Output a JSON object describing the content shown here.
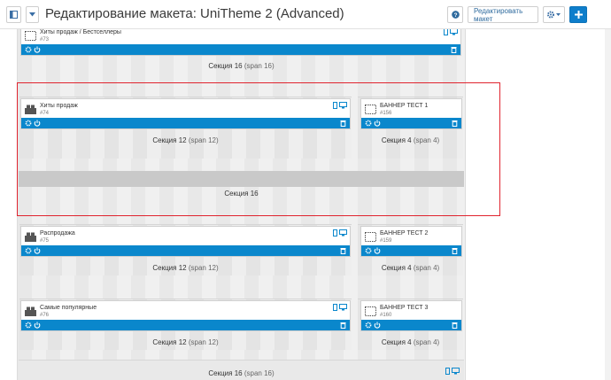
{
  "header": {
    "title": "Редактирование макета: UniTheme 2 (Advanced)",
    "edit_layout_label": "Редактировать макет",
    "icons": [
      "sidebar-toggle-icon",
      "chevron-down-icon",
      "help-icon",
      "gear-icon",
      "plus-icon"
    ]
  },
  "rows": [
    {
      "section_top": {
        "name": "Секция 16",
        "span": "(span 16)"
      },
      "blocks": [
        {
          "title": "Хиты продаж / Бестселлеры",
          "id": "#73",
          "icon": "template-icon"
        }
      ]
    },
    {
      "left": {
        "name": "Секция 12",
        "span": "(span 12)",
        "block": {
          "title": "Хиты продаж",
          "id": "#74",
          "icon": "products-icon"
        }
      },
      "right": {
        "name": "Секция 4",
        "span": "(span 4)",
        "block": {
          "title": "БАННЕР ТЕСТ 1",
          "id": "#156",
          "icon": "template-icon"
        }
      },
      "container_label": "Секция 16"
    },
    {
      "left": {
        "name": "Секция 12",
        "span": "(span 12)",
        "block": {
          "title": "Распродажа",
          "id": "#75",
          "icon": "products-icon"
        }
      },
      "right": {
        "name": "Секция 4",
        "span": "(span 4)",
        "block": {
          "title": "БАННЕР ТЕСТ 2",
          "id": "#159",
          "icon": "template-icon"
        }
      }
    },
    {
      "left": {
        "name": "Секция 12",
        "span": "(span 12)",
        "block": {
          "title": "Самые популярные",
          "id": "#76",
          "icon": "products-icon"
        }
      },
      "right": {
        "name": "Секция 4",
        "span": "(span 4)",
        "block": {
          "title": "БАННЕР ТЕСТ 3",
          "id": "#160",
          "icon": "template-icon"
        }
      }
    },
    {
      "section_bottom": {
        "name": "Секция 16",
        "span": "(span 16)"
      }
    }
  ],
  "colors": {
    "action_bar": "#0a87cc",
    "primary_button": "#0e7ecb",
    "highlight": "#e0242f"
  }
}
